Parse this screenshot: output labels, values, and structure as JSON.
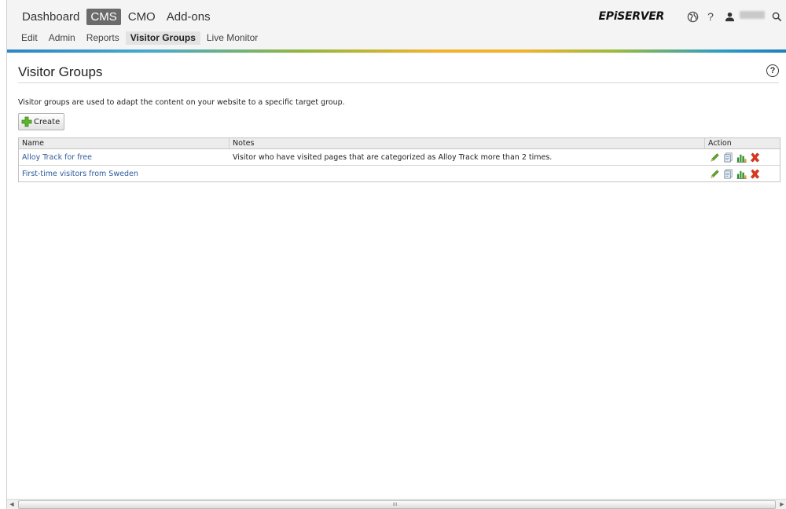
{
  "nav": {
    "primary": [
      "Dashboard",
      "CMS",
      "CMO",
      "Add-ons"
    ],
    "primary_active": "CMS",
    "secondary": [
      "Edit",
      "Admin",
      "Reports",
      "Visitor Groups",
      "Live Monitor"
    ],
    "secondary_active": "Visitor Groups",
    "brand": "EPiSERVER",
    "help": "?"
  },
  "page": {
    "title": "Visitor Groups",
    "help_badge": "?",
    "intro": "Visitor groups are used to adapt the content on your website to a specific target group.",
    "create_label": "Create"
  },
  "table": {
    "headers": {
      "name": "Name",
      "notes": "Notes",
      "action": "Action"
    },
    "rows": [
      {
        "name": "Alloy Track for free",
        "notes": "Visitor who have visited pages that are categorized as Alloy Track more than 2 times."
      },
      {
        "name": "First-time visitors from Sweden",
        "notes": ""
      }
    ],
    "actions": [
      "edit-icon",
      "copy-icon",
      "statistics-icon",
      "delete-icon"
    ]
  },
  "scrollbar": {
    "grip": "III"
  },
  "colors": {
    "link": "#2d5b9c",
    "active_tab": "#6b6b6b",
    "delete": "#e03a1e",
    "edit": "#6aaa2a"
  }
}
